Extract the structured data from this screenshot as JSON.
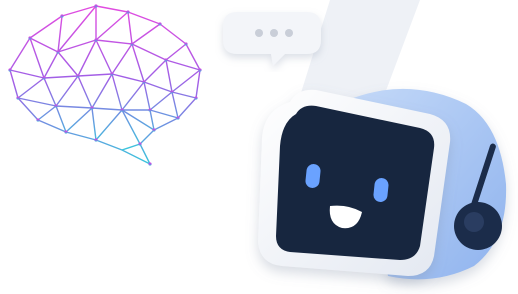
{
  "scene": {
    "background_color": "#ffffff",
    "stripe_color": "#eef1f6"
  },
  "brain": {
    "icon": "brain-network-icon",
    "gradient_top": "#e24be0",
    "gradient_mid": "#a15fe6",
    "gradient_bottom": "#3ac6dc"
  },
  "chat_bubble": {
    "icon": "chat-bubble-typing-icon",
    "fill": "#f3f5f9",
    "dot_color": "#c9ced8"
  },
  "robot": {
    "icon": "robot-mascot-icon",
    "frame_color": "#f4f6fb",
    "screen_color": "#17263f",
    "eye_color": "#6aa2ff",
    "mouth_color": "#ffffff",
    "body_color": "#a8c7f5",
    "antenna_color": "#1b2c4a"
  }
}
